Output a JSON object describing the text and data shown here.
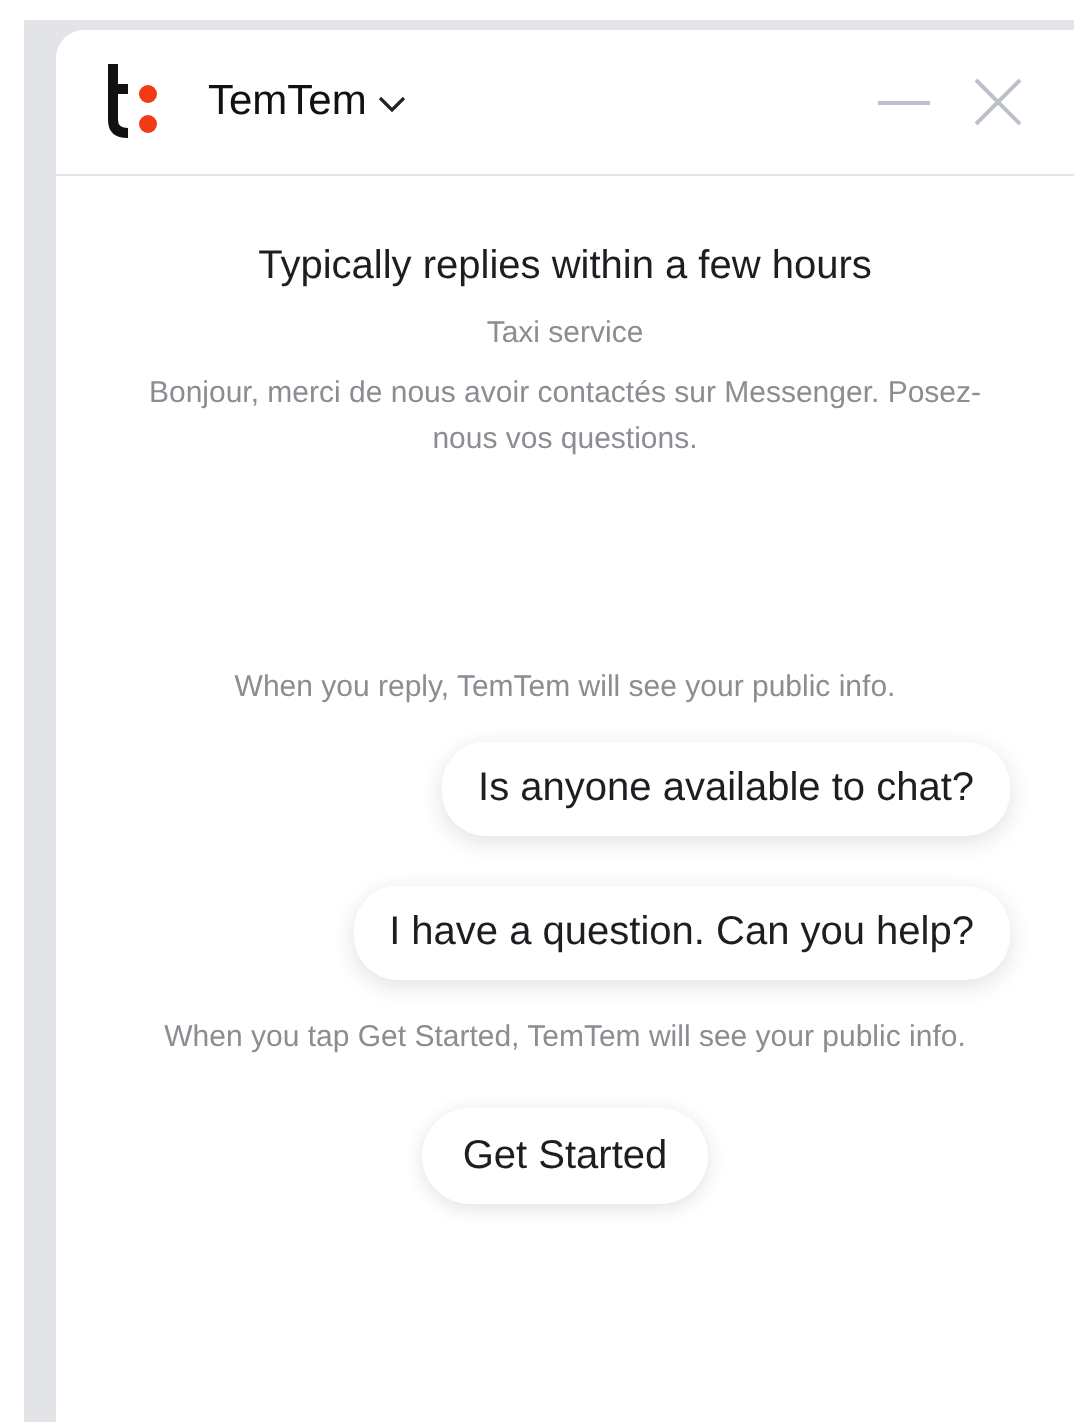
{
  "header": {
    "title": "TemTem"
  },
  "intro": {
    "response_time": "Typically replies within a few hours",
    "category": "Taxi service",
    "greeting": "Bonjour, merci de nous avoir contactés sur Messenger. Posez-nous vos questions."
  },
  "reply_notice": "When you reply, TemTem will see your public info.",
  "suggestions": [
    {
      "text": "Is anyone available to chat?"
    },
    {
      "text": "I have a question. Can you help?"
    }
  ],
  "start_notice": "When you tap Get Started, TemTem will see your public info.",
  "start_button": "Get Started"
}
